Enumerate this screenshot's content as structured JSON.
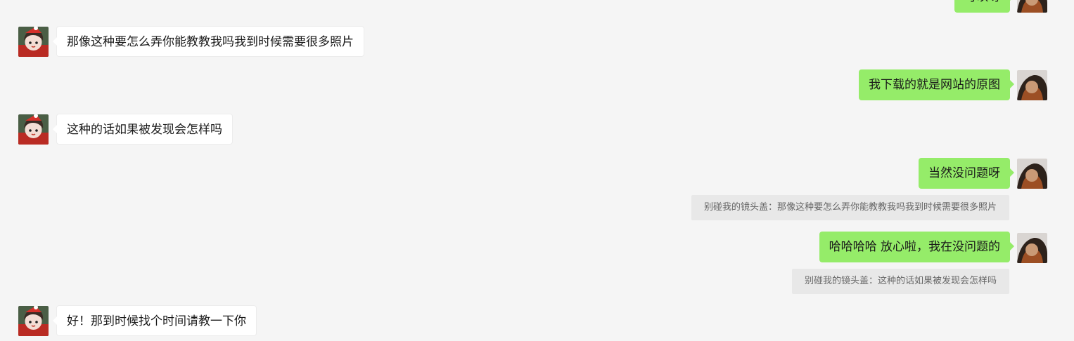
{
  "chat": {
    "messages": [
      {
        "side": "out",
        "text": "可以呀"
      },
      {
        "side": "in",
        "text": "那像这种要怎么弄你能教教我吗我到时候需要很多照片"
      },
      {
        "side": "out",
        "text": "我下载的就是网站的原图"
      },
      {
        "side": "in",
        "text": "这种的话如果被发现会怎样吗"
      },
      {
        "side": "out",
        "text": "当然没问题呀",
        "quote": "别碰我的镜头盖：那像这种要怎么弄你能教教我吗我到时候需要很多照片"
      },
      {
        "side": "out",
        "text": "哈哈哈哈 放心啦，我在没问题的",
        "quote": "别碰我的镜头盖：这种的话如果被发现会怎样吗"
      },
      {
        "side": "in",
        "text": "好！那到时候找个时间请教一下你"
      }
    ]
  },
  "colors": {
    "background": "#f5f5f5",
    "incoming_bubble": "#ffffff",
    "outgoing_bubble": "#95ec69",
    "quote_bg": "#e8e8e8",
    "quote_text": "#666666"
  },
  "icons": {
    "incoming_avatar": "contact-avatar-icon",
    "outgoing_avatar": "self-avatar-icon"
  }
}
